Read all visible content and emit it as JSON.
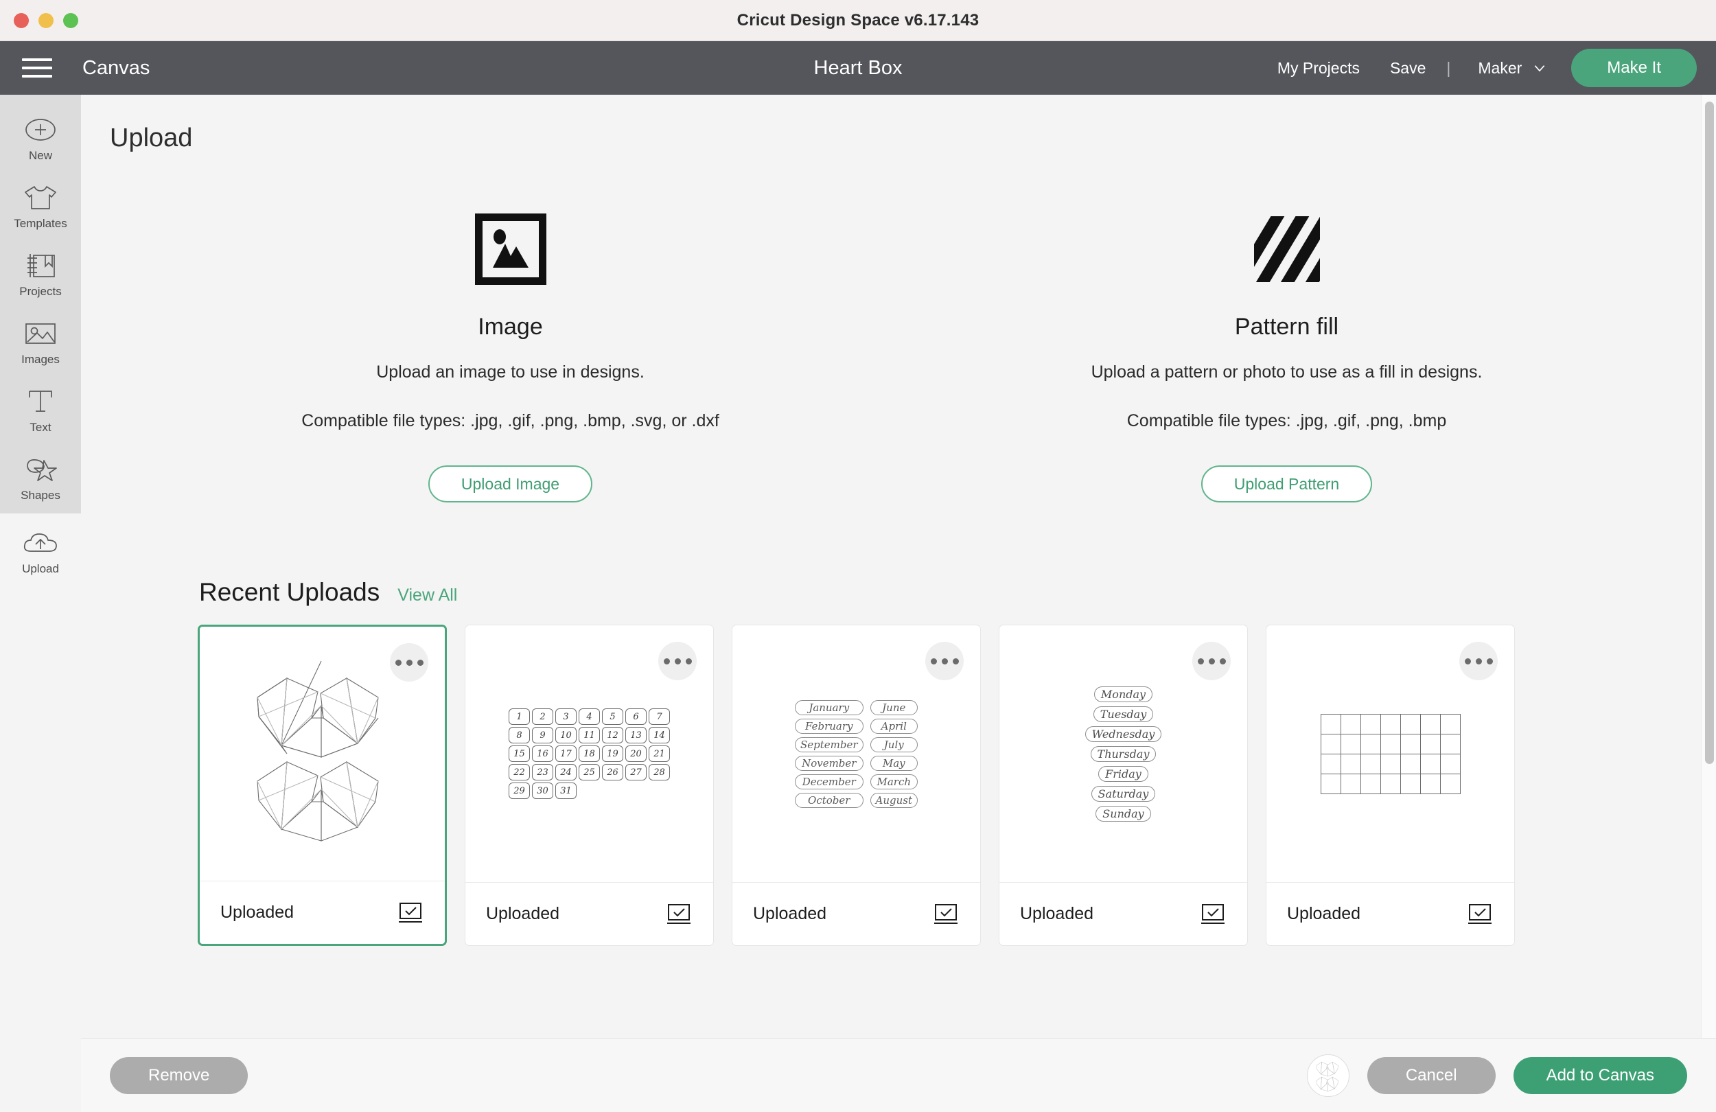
{
  "window": {
    "title": "Cricut Design Space  v6.17.143",
    "traffic_lights": [
      "close",
      "minimize",
      "maximize"
    ],
    "colors": {
      "close": "#e8605a",
      "minimize": "#f0bf4c",
      "maximize": "#5cc254"
    }
  },
  "appbar": {
    "menu_icon": "hamburger-menu-icon",
    "canvas_label": "Canvas",
    "doc_title": "Heart Box",
    "my_projects_label": "My Projects",
    "save_label": "Save",
    "divider": "|",
    "machine_name": "Maker",
    "machine_chevron": "chevron-down-icon",
    "make_it_label": "Make It",
    "accent_green": "#4aa57c",
    "bar_bg": "#54565b"
  },
  "sidebar": {
    "items": [
      {
        "label": "New",
        "icon": "plus-circle-icon"
      },
      {
        "label": "Templates",
        "icon": "tshirt-icon"
      },
      {
        "label": "Projects",
        "icon": "book-bookmark-icon"
      },
      {
        "label": "Images",
        "icon": "picture-icon"
      },
      {
        "label": "Text",
        "icon": "text-t-icon"
      },
      {
        "label": "Shapes",
        "icon": "shapes-star-icon"
      }
    ],
    "upload": {
      "label": "Upload",
      "icon": "cloud-upload-icon",
      "active": true
    }
  },
  "page": {
    "title": "Upload"
  },
  "choices": [
    {
      "key": "image",
      "icon": "image-frame-icon",
      "title": "Image",
      "description": "Upload an image to use in designs.",
      "file_types": "Compatible file types: .jpg, .gif, .png, .bmp, .svg, or .dxf",
      "button_label": "Upload Image"
    },
    {
      "key": "pattern",
      "icon": "diagonal-stripes-icon",
      "title": "Pattern fill",
      "description": "Upload a pattern or photo to use as a fill in designs.",
      "file_types": "Compatible file types: .jpg, .gif, .png, .bmp",
      "button_label": "Upload Pattern"
    }
  ],
  "recent": {
    "heading": "Recent Uploads",
    "view_all_label": "View All",
    "cards": [
      {
        "status": "Uploaded",
        "thumb": "geometric-heart-box",
        "selected": true,
        "kebab": "more-options-icon",
        "type_icon": "cut-type-icon"
      },
      {
        "status": "Uploaded",
        "thumb": "calendar-numbers",
        "selected": false,
        "kebab": "more-options-icon",
        "type_icon": "cut-type-icon"
      },
      {
        "status": "Uploaded",
        "thumb": "month-names-script",
        "selected": false,
        "kebab": "more-options-icon",
        "type_icon": "cut-type-icon"
      },
      {
        "status": "Uploaded",
        "thumb": "weekday-names-script",
        "selected": false,
        "kebab": "more-options-icon",
        "type_icon": "cut-type-icon"
      },
      {
        "status": "Uploaded",
        "thumb": "calendar-grid",
        "selected": false,
        "kebab": "more-options-icon",
        "type_icon": "cut-type-icon"
      }
    ],
    "thumbs": {
      "calendar_numbers": [
        "1",
        "2",
        "3",
        "4",
        "5",
        "6",
        "7",
        "8",
        "9",
        "10",
        "11",
        "12",
        "13",
        "14",
        "15",
        "16",
        "17",
        "18",
        "19",
        "20",
        "21",
        "22",
        "23",
        "24",
        "25",
        "26",
        "27",
        "28",
        "29",
        "30",
        "31"
      ],
      "month_names": [
        "January",
        "June",
        "February",
        "April",
        "September",
        "July",
        "November",
        "May",
        "December",
        "March",
        "October",
        "August"
      ],
      "weekday_names": [
        "Monday",
        "Tuesday",
        "Wednesday",
        "Thursday",
        "Friday",
        "Saturday",
        "Sunday"
      ],
      "grid_columns": 7,
      "grid_rows": 4
    }
  },
  "actionbar": {
    "remove_label": "Remove",
    "cancel_label": "Cancel",
    "add_to_canvas_label": "Add to Canvas",
    "preview_thumb": "geometric-heart-box"
  }
}
